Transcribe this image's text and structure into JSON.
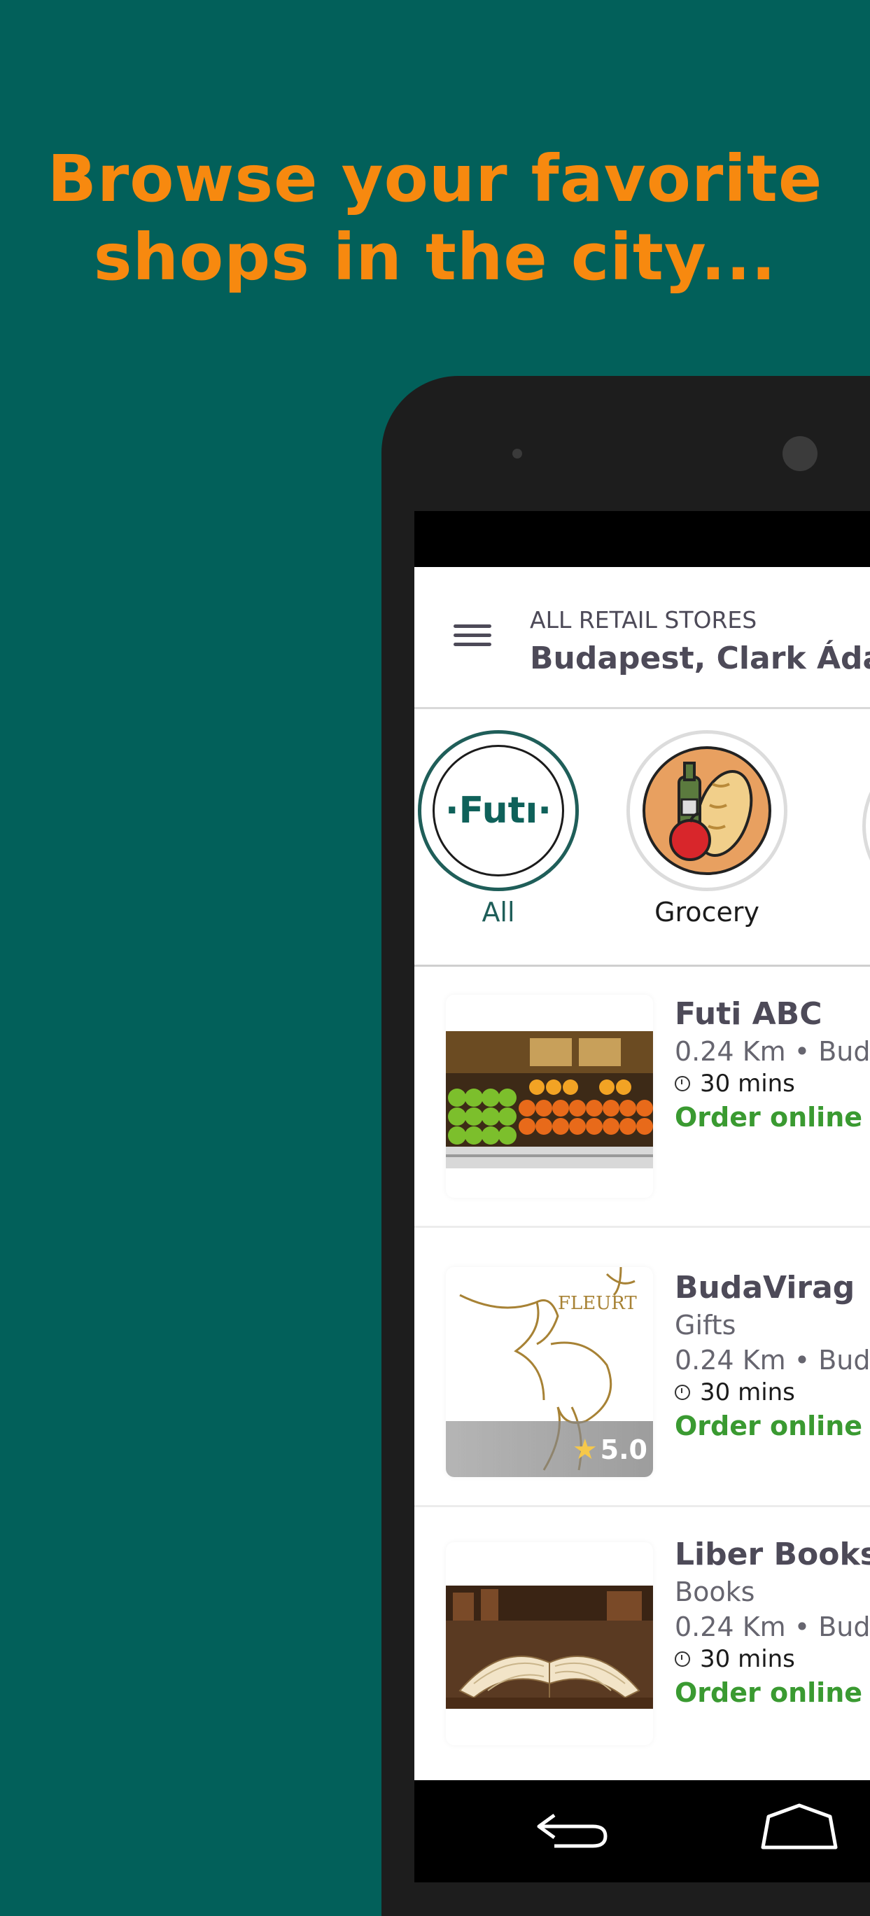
{
  "headline": {
    "line1": "Browse your favorite",
    "line2": "shops in the city..."
  },
  "appbar": {
    "subtitle": "ALL RETAIL STORES",
    "location": "Budapest, Clark Ádám"
  },
  "categories": [
    {
      "label": "All",
      "logo_text": "·Futı·",
      "selected": true
    },
    {
      "label": "Grocery",
      "selected": false
    }
  ],
  "stores": [
    {
      "name": "Futi ABC",
      "category": "",
      "distance": "0.24 Km • Bud",
      "time": "30 mins",
      "action": "Order online"
    },
    {
      "name": "BudaVirag",
      "category": "Gifts",
      "distance": "0.24 Km • Bud",
      "time": "30 mins",
      "action": "Order online",
      "rating": "5.0",
      "logo_text": "FLEURT"
    },
    {
      "name": "Liber Books",
      "category": "Books",
      "distance": "0.24 Km • Bud",
      "time": "30 mins",
      "action": "Order online"
    }
  ],
  "colors": {
    "background": "#02605a",
    "headline": "#f7890f",
    "order_link": "#3a9a31",
    "text_dark": "#4d4a58"
  }
}
